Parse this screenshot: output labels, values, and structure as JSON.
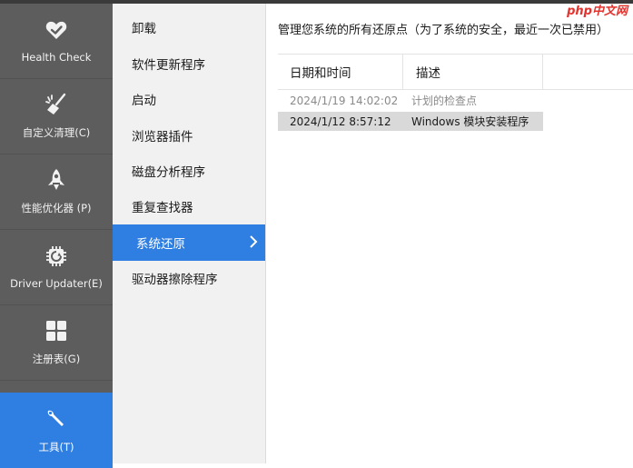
{
  "brand": {
    "watermark": "php中文网"
  },
  "nav": {
    "items": [
      {
        "label": "Health Check",
        "icon": "heart-icon"
      },
      {
        "label": "自定义清理(C)",
        "icon": "broom-icon"
      },
      {
        "label": "性能优化器 (P)",
        "icon": "rocket-icon"
      },
      {
        "label": "Driver Updater(E)",
        "icon": "chip-icon"
      },
      {
        "label": "注册表(G)",
        "icon": "grid-icon"
      },
      {
        "label": "工具(T)",
        "icon": "wrench-icon",
        "active": true
      }
    ]
  },
  "submenu": {
    "items": [
      {
        "label": "卸载"
      },
      {
        "label": "软件更新程序"
      },
      {
        "label": "启动"
      },
      {
        "label": "浏览器插件"
      },
      {
        "label": "磁盘分析程序"
      },
      {
        "label": "重复查找器"
      },
      {
        "label": "系统还原",
        "active": true
      },
      {
        "label": "驱动器擦除程序"
      }
    ]
  },
  "main": {
    "description": "管理您系统的所有还原点（为了系统的安全，最近一次已禁用）",
    "table": {
      "columns": [
        "日期和时间",
        "描述"
      ],
      "rows": [
        {
          "date": "2024/1/19 14:02:02",
          "desc": "计划的检查点",
          "state": "disabled"
        },
        {
          "date": "2024/1/12 8:57:12",
          "desc": "Windows 模块安装程序",
          "state": "selected"
        }
      ]
    }
  },
  "colors": {
    "accent": "#2f7ee2",
    "nav_bg": "#5d5d5d",
    "submenu_bg": "#f1f1f1"
  }
}
